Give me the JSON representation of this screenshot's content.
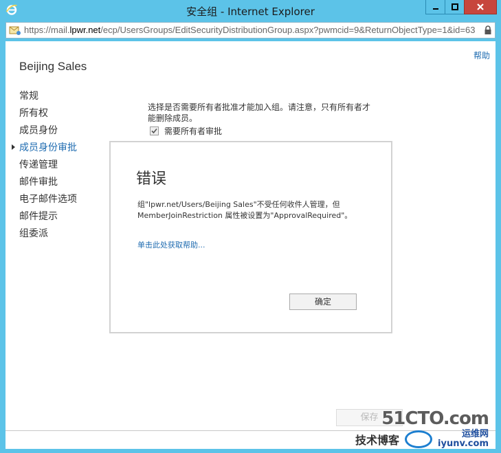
{
  "window": {
    "title": "安全组 - Internet Explorer",
    "url_prefix": "https://mail.",
    "url_domain": "lpwr.net",
    "url_path": "/ecp/UsersGroups/EditSecurityDistributionGroup.aspx?pwmcid=9&ReturnObjectType=1&id=63"
  },
  "page": {
    "help_label": "帮助",
    "title": "Beijing Sales",
    "nav_items": [
      {
        "label": "常规",
        "active": false
      },
      {
        "label": "所有权",
        "active": false
      },
      {
        "label": "成员身份",
        "active": false
      },
      {
        "label": "成员身份审批",
        "active": true
      },
      {
        "label": "传递管理",
        "active": false
      },
      {
        "label": "邮件审批",
        "active": false
      },
      {
        "label": "电子邮件选项",
        "active": false
      },
      {
        "label": "邮件提示",
        "active": false
      },
      {
        "label": "组委派",
        "active": false
      }
    ],
    "description": "选择是否需要所有者批准才能加入组。请注意，只有所有者才能删除成员。",
    "approval_checkbox": {
      "label": "需要所有者审批",
      "checked": true
    },
    "save_label": "保存"
  },
  "dialog": {
    "title": "错误",
    "message": "组\"lpwr.net/Users/Beijing Sales\"不受任何收件人管理，但 MemberJoinRestriction 属性被设置为\"ApprovalRequired\"。",
    "help_link": "单击此处获取帮助...",
    "ok_label": "确定"
  },
  "watermark": {
    "brand": "51CTO.com",
    "tagline": "技术博客",
    "badge": "运维网",
    "site": "iyunv.com"
  },
  "colors": {
    "frame": "#5cc3e8",
    "close_button": "#c7463d",
    "link": "#1e6bb0"
  }
}
